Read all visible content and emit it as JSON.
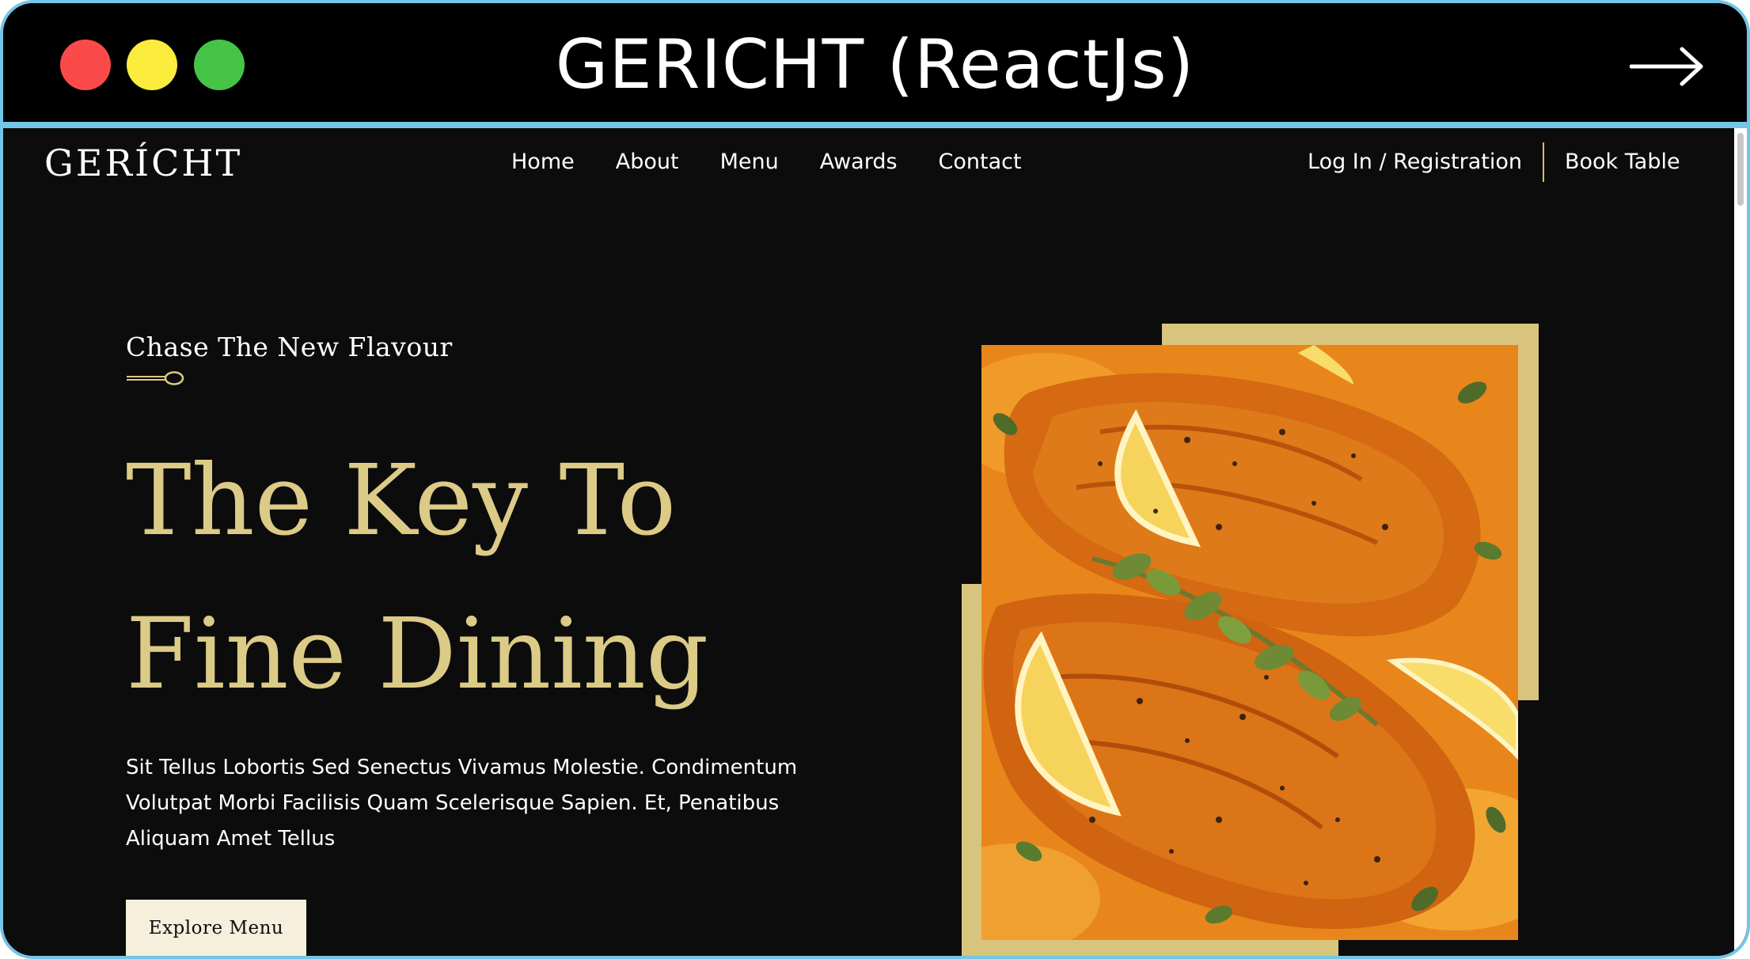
{
  "window": {
    "title": "GERICHT (ReactJs)",
    "icon": "arrow-right-icon"
  },
  "colors": {
    "gold": "#dcca87",
    "gold_block": "#d9c47d",
    "background": "#0c0c0c",
    "frame_border": "#72c6e6",
    "button_bg": "#f5efdb"
  },
  "navbar": {
    "logo": "GERÍCHT",
    "links": [
      "Home",
      "About",
      "Menu",
      "Awards",
      "Contact"
    ],
    "login_label": "Log In / Registration",
    "book_label": "Book Table"
  },
  "hero": {
    "subtitle": "Chase The New Flavour",
    "subtitle_icon": "spoon-icon",
    "headline_line1": "The Key To",
    "headline_line2": "Fine Dining",
    "description": "Sit Tellus Lobortis Sed Senectus Vivamus Molestie. Condimentum Volutpat Morbi Facilisis Quam Scelerisque Sapien. Et, Penatibus Aliquam Amet Tellus",
    "button_label": "Explore Menu"
  }
}
